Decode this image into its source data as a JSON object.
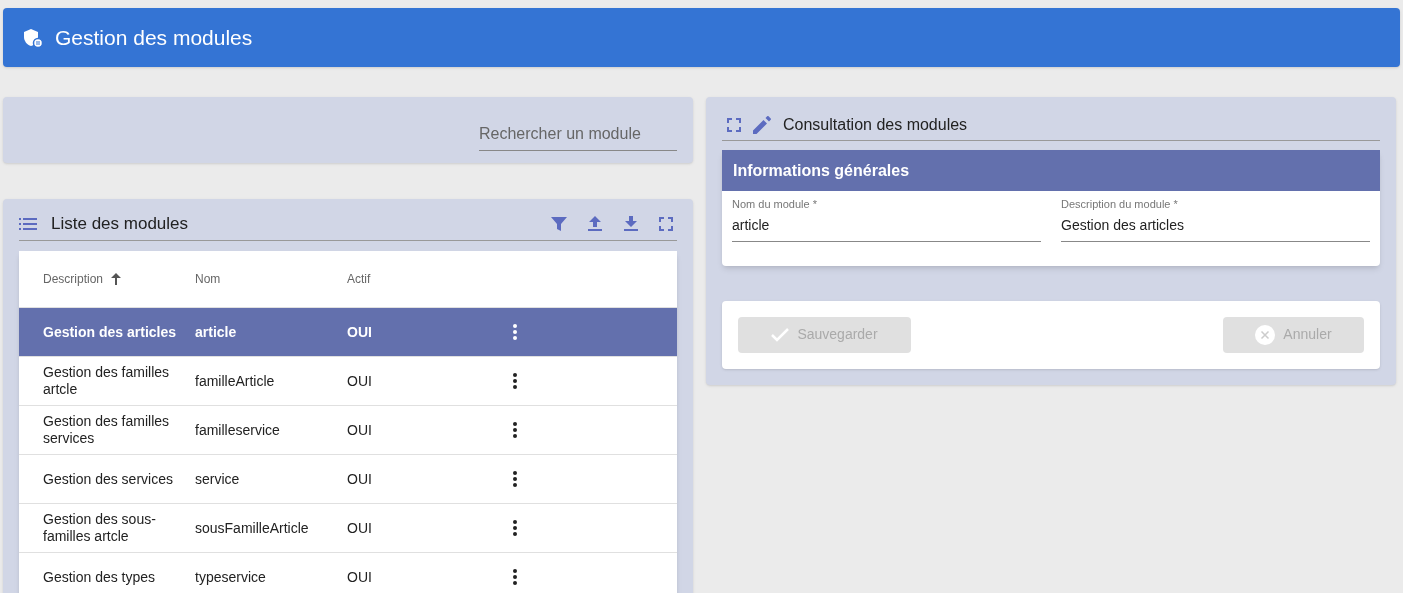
{
  "header": {
    "title": "Gestion des modules"
  },
  "search": {
    "placeholder": "Rechercher un module"
  },
  "list": {
    "title": "Liste des modules",
    "columns": [
      {
        "label": "Description",
        "sorted": true
      },
      {
        "label": "Nom",
        "sorted": false
      },
      {
        "label": "Actif",
        "sorted": false
      }
    ],
    "rows": [
      {
        "description": "Gestion des articles",
        "nom": "article",
        "actif": "OUI",
        "selected": true
      },
      {
        "description": "Gestion des familles artcle",
        "nom": "familleArticle",
        "actif": "OUI",
        "selected": false
      },
      {
        "description": "Gestion des familles services",
        "nom": "familleservice",
        "actif": "OUI",
        "selected": false
      },
      {
        "description": "Gestion des services",
        "nom": "service",
        "actif": "OUI",
        "selected": false
      },
      {
        "description": "Gestion des sous-familles artcle",
        "nom": "sousFamilleArticle",
        "actif": "OUI",
        "selected": false
      },
      {
        "description": "Gestion des types",
        "nom": "typeservice",
        "actif": "OUI",
        "selected": false
      }
    ]
  },
  "detail": {
    "title": "Consultation des modules",
    "section": "Informations générales",
    "fields": [
      {
        "label": "Nom du module *",
        "value": "article"
      },
      {
        "label": "Description du module *",
        "value": "Gestion des articles"
      }
    ],
    "buttons": [
      {
        "kind": "save",
        "label": "Sauvegarder",
        "disabled": true
      },
      {
        "kind": "cancel",
        "label": "Annuler",
        "disabled": true
      }
    ]
  }
}
